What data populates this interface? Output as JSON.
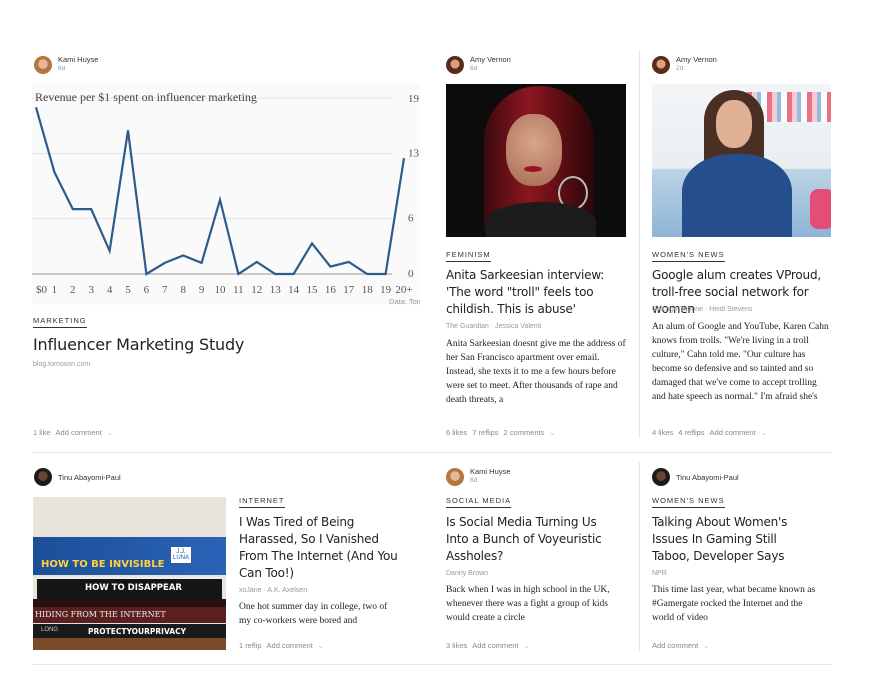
{
  "cards": [
    {
      "author": "Kami Huyse",
      "time": "6d",
      "category": "MARKETING",
      "title": "Influencer Marketing Study",
      "source": "blog.tomoson.com",
      "actions": [
        "1 like",
        "Add comment"
      ]
    },
    {
      "author": "Amy Vernon",
      "time": "6d",
      "category": "FEMINISM",
      "title": "Anita Sarkeesian interview: 'The word \"troll\" feels too childish. This is abuse'",
      "source": "The Guardian · Jessica Valenti",
      "excerpt": "Anita Sarkeesian doesnt give me the address of her San Francisco apartment over email. Instead, she texts it to me a few hours before were set to meet. After thousands of rape and death threats, a",
      "actions": [
        "6 likes",
        "7 reflips",
        "2 comments"
      ]
    },
    {
      "author": "Amy Vernon",
      "time": "2d",
      "category": "WOMEN'S NEWS",
      "title": "Google alum creates VProud, troll-free social network for women",
      "source": "Chicago Tribune · Heidi Stevens",
      "excerpt": "An alum of Google and YouTube, Karen Cahn knows from trolls. \"We're living in a troll culture,\" Cahn told me. \"Our culture has become so defensive and so tainted and so damaged that we've come to accept trolling and hate speech as normal.\" I'm afraid she's right. The majority of",
      "actions": [
        "4 likes",
        "4 reflips",
        "Add comment"
      ]
    },
    {
      "author": "Tinu Abayomi-Paul",
      "time": "",
      "category": "INTERNET",
      "title": "I Was Tired of Being Harassed, So I Vanished From The Internet (And You Can Too!)",
      "source": "xoJane · A.K. Axelsen",
      "excerpt": "One hot summer day in college, two of my co-workers were bored and",
      "actions": [
        "1 reflip",
        "Add comment"
      ],
      "book_titles": [
        "HOW TO BE INVISIBLE",
        "J.J. LUNA",
        "HOW TO DISAPPEAR",
        "HIDING FROM THE INTERNET",
        "PROTECTYOURPRIVACY",
        "LONG"
      ]
    },
    {
      "author": "Kami Huyse",
      "time": "6d",
      "category": "SOCIAL MEDIA",
      "title": "Is Social Media Turning Us Into a Bunch of Voyeuristic Assholes?",
      "source": "Danny Brown",
      "excerpt": "Back when I was in high school in the UK, whenever there was a fight a group of kids would create a circle",
      "actions": [
        "3 likes",
        "Add comment"
      ]
    },
    {
      "author": "Tinu Abayomi-Paul",
      "time": "",
      "category": "WOMEN'S NEWS",
      "title": "Talking About Women's Issues In Gaming Still Taboo, Developer Says",
      "source": "NPR",
      "excerpt": "This time last year, what became known as #Gamergate rocked the Internet and the world of video",
      "actions": [
        "Add comment"
      ]
    }
  ],
  "chart_data": {
    "type": "line",
    "title": "Revenue per $1 spent on influencer marketing",
    "x": [
      "$0",
      "1",
      "2",
      "3",
      "4",
      "5",
      "6",
      "7",
      "8",
      "9",
      "10",
      "11",
      "12",
      "13",
      "14",
      "15",
      "16",
      "17",
      "18",
      "19",
      "20+"
    ],
    "values": [
      18,
      11,
      7,
      7,
      2.5,
      15.5,
      0,
      1.2,
      2,
      1.2,
      8,
      0,
      1.3,
      0,
      0,
      3.3,
      0.8,
      1.3,
      0,
      0,
      12.5
    ],
    "yticks": [
      0,
      6,
      13,
      19
    ],
    "ylim": [
      0,
      19
    ],
    "color": "#2e5c8a",
    "credit": "Data: Tomoson"
  },
  "colors": {
    "line": "#2e5c8a",
    "divider": "#e6e6e6",
    "muted": "#999999"
  }
}
